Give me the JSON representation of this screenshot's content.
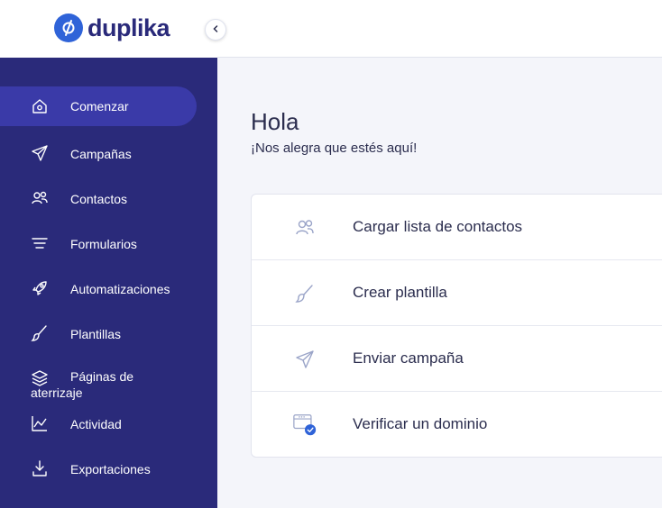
{
  "brand": {
    "name": "duplika",
    "accent": "#2f63d8",
    "sidebar_bg": "#2a2a7a",
    "active_bg": "#3a3aa8"
  },
  "sidebar": {
    "items": [
      {
        "label": "Comenzar",
        "icon": "home-icon",
        "active": true
      },
      {
        "label": "Campañas",
        "icon": "paper-plane-icon"
      },
      {
        "label": "Contactos",
        "icon": "users-icon"
      },
      {
        "label": "Formularios",
        "icon": "lines-icon"
      },
      {
        "label": "Automatizaciones",
        "icon": "rocket-icon"
      },
      {
        "label": "Plantillas",
        "icon": "brush-icon"
      },
      {
        "label": "Páginas de",
        "label2": "aterrizaje",
        "icon": "layers-icon"
      },
      {
        "label": "Actividad",
        "icon": "chart-icon"
      },
      {
        "label": "Exportaciones",
        "icon": "download-icon"
      }
    ]
  },
  "main": {
    "title": "Hola",
    "subtitle": "¡Nos alegra que estés aquí!",
    "tasks": [
      {
        "label": "Cargar lista de contactos",
        "icon": "users-icon"
      },
      {
        "label": "Crear plantilla",
        "icon": "brush-icon"
      },
      {
        "label": "Enviar campaña",
        "icon": "paper-plane-icon"
      },
      {
        "label": "Verificar un dominio",
        "icon": "domain-check-icon"
      }
    ]
  }
}
